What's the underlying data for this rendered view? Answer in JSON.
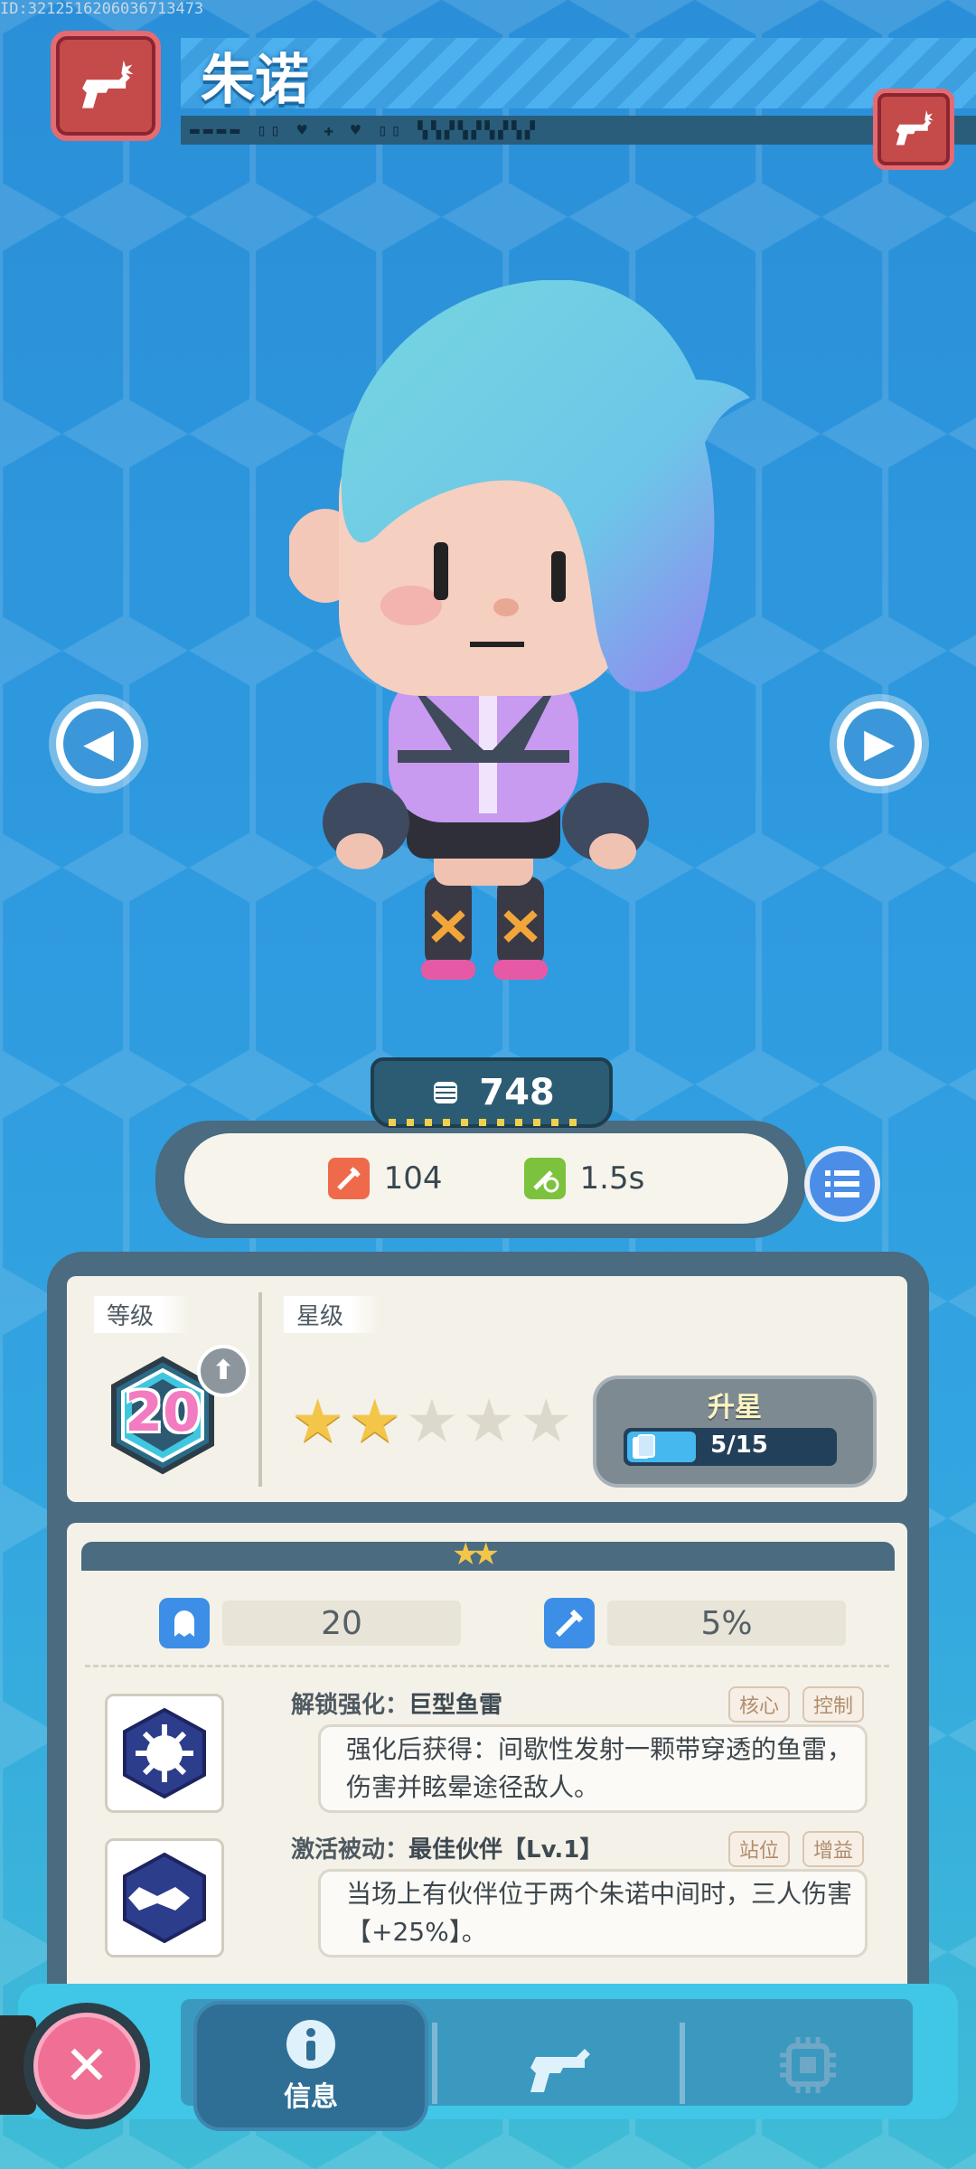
{
  "debug_id": "ID:3212516206036713473",
  "hero": {
    "name": "朱诺",
    "header_codes": "▬▬▬▬ ▯▯ ♥ ✚ ♥ ▯▯ ▚▚▞▚▞▚▞▚▞"
  },
  "power": {
    "value": "748",
    "icon": "fist-icon"
  },
  "stats": {
    "attack": "104",
    "attack_icon": "sword-icon",
    "cooldown": "1.5s",
    "cooldown_icon": "sword-clock-icon"
  },
  "level": {
    "label": "等级",
    "value": "20"
  },
  "star": {
    "label": "星级",
    "filled": 2,
    "total": 5,
    "upgrade_label": "升星",
    "progress_text": "5/15",
    "progress_fraction": 0.333
  },
  "attributes": [
    {
      "icon": "ghost-up-icon",
      "value": "20"
    },
    {
      "icon": "sword-up-icon",
      "value": "5%"
    }
  ],
  "skills": [
    {
      "prefix": "解锁强化：",
      "name": "巨型鱼雷",
      "tags": [
        "核心",
        "控制"
      ],
      "description": "强化后获得：间歇性发射一颗带穿透的鱼雷，伤害并眩晕途径敌人。",
      "icon": "explosion-icon"
    },
    {
      "prefix": "激活被动：",
      "name": "最佳伙伴【Lv.1】",
      "tags": [
        "站位",
        "增益"
      ],
      "description": "当场上有伙伴位于两个朱诺中间时，三人伤害【+25%】。",
      "icon": "handshake-icon"
    }
  ],
  "bottom_nav": {
    "info_label": "信息"
  },
  "colors": {
    "accent_red": "#c54a4a",
    "accent_blue": "#3c8ee6",
    "star_gold": "#f3c64a",
    "level_pink": "#f27bc1"
  }
}
